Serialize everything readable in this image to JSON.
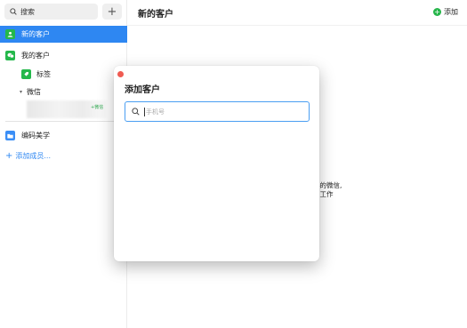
{
  "sidebar": {
    "search_placeholder": "搜索",
    "add_symbol": "+",
    "items": [
      {
        "label": "新的客户"
      },
      {
        "label": "我的客户"
      }
    ],
    "sub_items": [
      {
        "label": "标签"
      }
    ],
    "wechat_group": {
      "label": "微信",
      "caret": "▾"
    },
    "contact_tag": "+微信",
    "group_item": {
      "label": "编码美学"
    },
    "add_member": {
      "plus": "+",
      "label": "添加成员..."
    }
  },
  "main": {
    "title": "新的客户",
    "add_label": "添加",
    "add_symbol": "+",
    "background_text": [
      "伴的微信,",
      "部工作"
    ]
  },
  "modal": {
    "title": "添加客户",
    "input_placeholder": "手机号",
    "input_value": ""
  },
  "colors": {
    "accent": "#2e87f2",
    "green": "#24b84b",
    "close_dot": "#f05b52",
    "input_border": "#4a9ef2"
  },
  "icons": [
    "search-icon",
    "plus-icon",
    "new-customer-icon",
    "my-customers-icon",
    "tag-icon",
    "folder-icon",
    "close-icon"
  ]
}
